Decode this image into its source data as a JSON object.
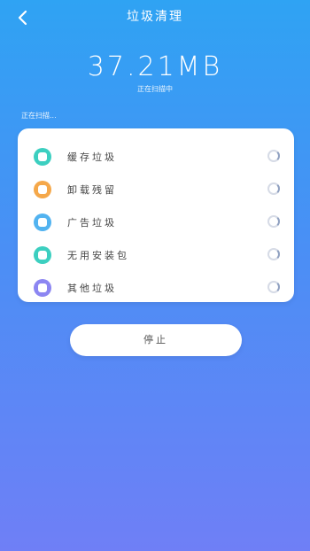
{
  "header": {
    "title": "垃圾清理"
  },
  "summary": {
    "size": "37.21MB",
    "subtitle": "正在扫描中",
    "scan_status": "正在扫描..."
  },
  "items": [
    {
      "label": "缓存垃圾",
      "icon": "cache-icon",
      "color": "#3ccfc0"
    },
    {
      "label": "卸载残留",
      "icon": "uninstall-icon",
      "color": "#f5a84a"
    },
    {
      "label": "广告垃圾",
      "icon": "ad-icon",
      "color": "#52b3f0"
    },
    {
      "label": "无用安装包",
      "icon": "package-icon",
      "color": "#3ccfc0"
    },
    {
      "label": "其他垃圾",
      "icon": "other-icon",
      "color": "#8c86f2"
    }
  ],
  "footer": {
    "stop_label": "停止"
  }
}
